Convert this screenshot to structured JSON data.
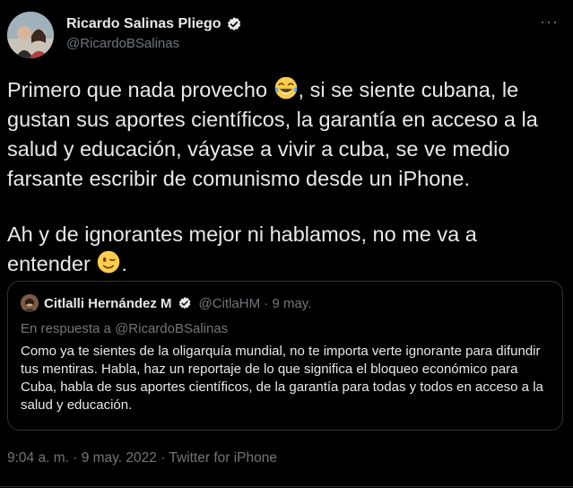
{
  "author": {
    "name": "Ricardo Salinas Pliego",
    "handle": "@RicardoBSalinas",
    "verified": true
  },
  "tweet": {
    "paragraph1_a": "Primero que nada provecho ",
    "paragraph1_b": ", si se siente cubana, le gustan sus aportes científicos, la garantía en acceso a la salud y educación, váyase a vivir a cuba, se ve medio farsante escribir de comunismo desde un iPhone.",
    "paragraph2_a": "Ah y de ignorantes mejor ni hablamos, no me va a entender ",
    "paragraph2_b": "."
  },
  "quote": {
    "name": "Citlalli Hernández M",
    "verified": true,
    "handle": "@CitlaHM",
    "separator": " · ",
    "date": "9 may.",
    "reply_to": "En respuesta a @RicardoBSalinas",
    "text": "Como ya te sientes de la oligarquía mundial, no te importa verte ignorante para difundir tus mentiras. Habla, haz un reportaje de lo que significa el bloqueo económico para Cuba, habla de sus aportes científicos, de la garantía para todas y todos en acceso a la salud y educación."
  },
  "footer": {
    "time": "9:04 a. m.",
    "date": "9 may. 2022",
    "source": "Twitter for iPhone",
    "separator": " · "
  },
  "icons": {
    "more": "more-options-icon",
    "verified": "verified-badge-icon",
    "emoji1": "face-with-tears-of-joy-icon",
    "emoji2": "winking-face-icon"
  },
  "colors": {
    "background": "#000000",
    "text": "#e7e9ea",
    "muted": "#71767b",
    "border": "#2f3336"
  }
}
